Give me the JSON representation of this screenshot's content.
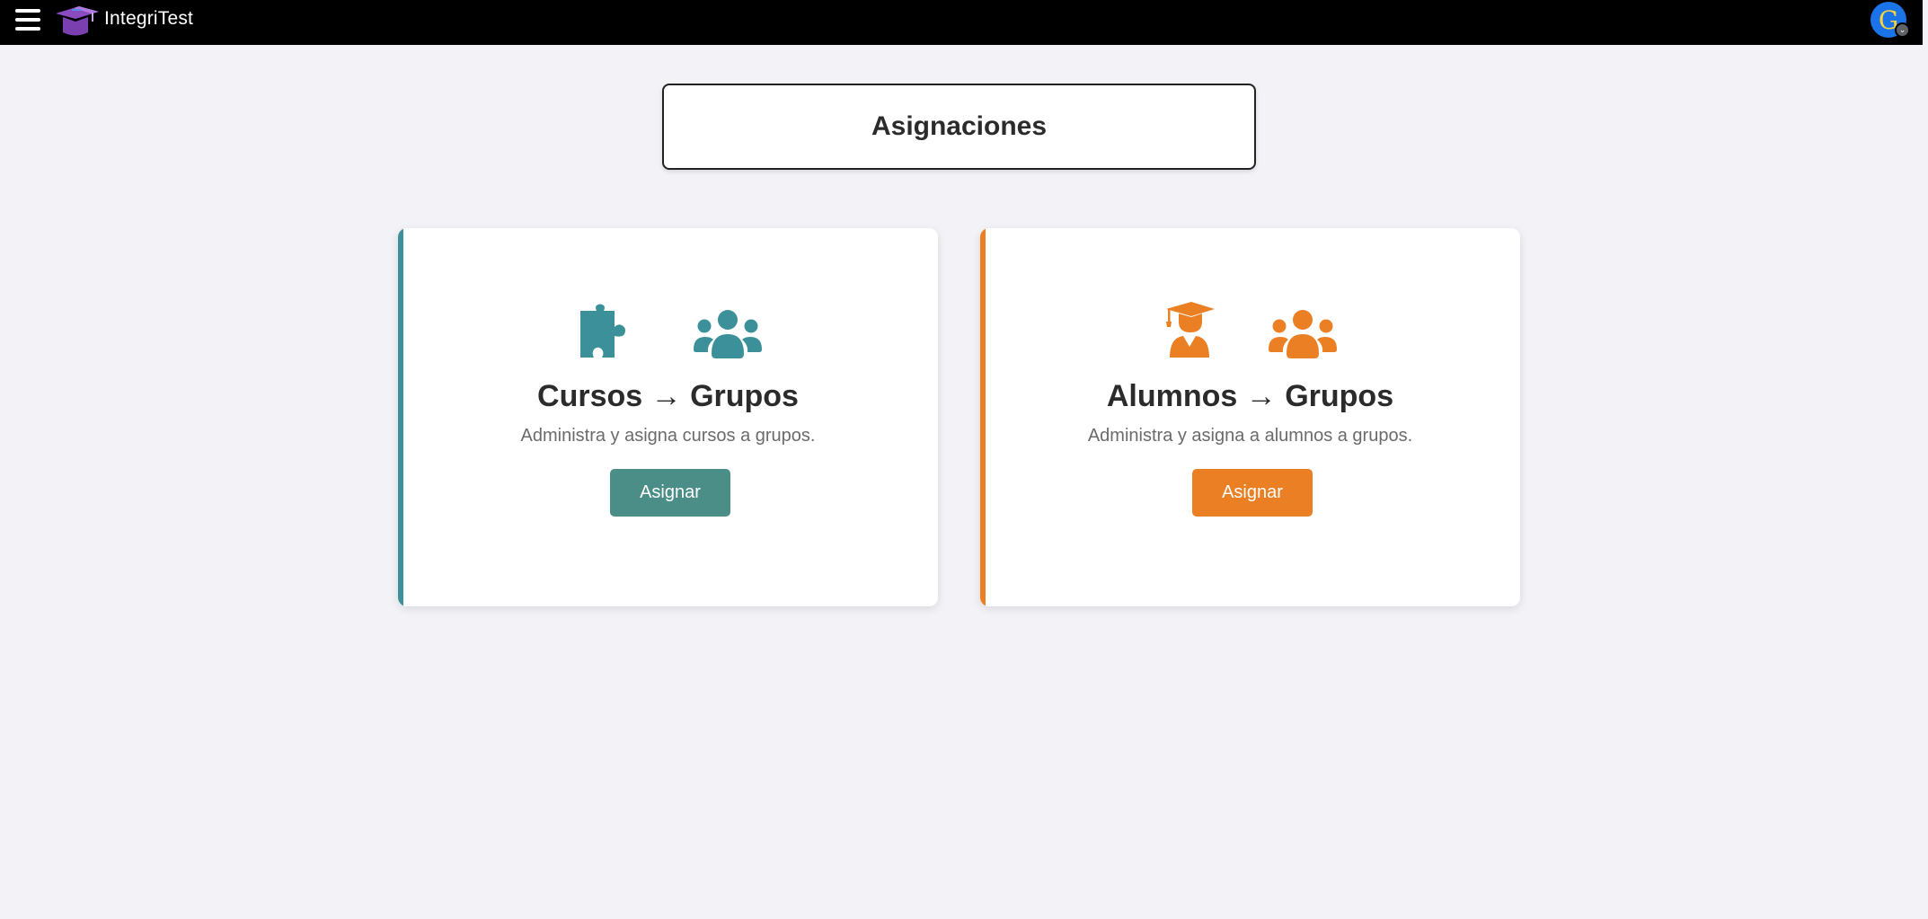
{
  "app": {
    "brand": "IntegriTest",
    "menu_icon": "hamburger-menu-icon",
    "logo_icon": "graduation-cap-logo-icon",
    "avatar_letter": "G"
  },
  "page": {
    "title": "Asignaciones"
  },
  "cards": [
    {
      "title": "Cursos → Grupos",
      "description": "Administra y asigna cursos a grupos.",
      "button_label": "Asignar",
      "icons": [
        "puzzle-piece-icon",
        "users-group-icon"
      ],
      "accent_color": "#3b9099",
      "button_color": "#4b8e87"
    },
    {
      "title": "Alumnos → Grupos",
      "description": "Administra y asigna a alumnos a grupos.",
      "button_label": "Asignar",
      "icons": [
        "graduate-student-icon",
        "users-group-icon"
      ],
      "accent_color": "#ea7f23",
      "button_color": "#ea7f23"
    }
  ],
  "colors": {
    "topbar": "#000000",
    "background": "#f2f2f7",
    "teal": "#3b9099",
    "orange": "#ea7f23"
  }
}
